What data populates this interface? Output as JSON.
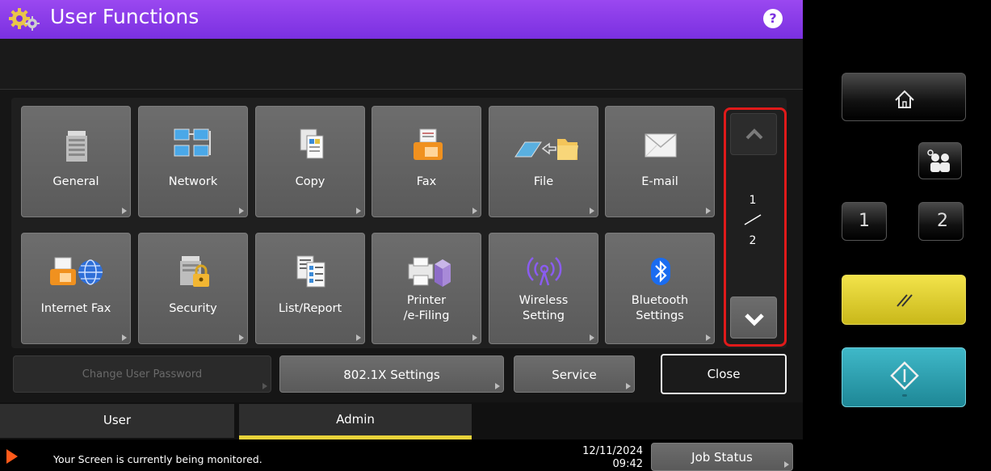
{
  "header": {
    "title": "User Functions",
    "help_label": "?"
  },
  "functions": [
    {
      "label": "General",
      "icon": "copier-icon"
    },
    {
      "label": "Network",
      "icon": "network-icon"
    },
    {
      "label": "Copy",
      "icon": "copy-icon"
    },
    {
      "label": "Fax",
      "icon": "fax-icon"
    },
    {
      "label": "File",
      "icon": "file-folder-icon"
    },
    {
      "label": "E-mail",
      "icon": "envelope-icon"
    },
    {
      "label": "Internet Fax",
      "icon": "internet-fax-icon"
    },
    {
      "label": "Security",
      "icon": "security-lock-icon"
    },
    {
      "label": "List/Report",
      "icon": "list-report-icon"
    },
    {
      "label_line1": "Printer",
      "label_line2": "/e-Filing",
      "icon": "printer-efiling-icon"
    },
    {
      "label_line1": "Wireless",
      "label_line2": "Setting",
      "icon": "wireless-icon"
    },
    {
      "label_line1": "Bluetooth",
      "label_line2": "Settings",
      "icon": "bluetooth-icon"
    }
  ],
  "pagination": {
    "current": "1",
    "total": "2"
  },
  "bottom_buttons": {
    "change_password": "Change User Password",
    "dot1x": "802.1X Settings",
    "service": "Service",
    "close": "Close"
  },
  "tabs": {
    "user": "User",
    "admin": "Admin",
    "active": "Admin"
  },
  "status": {
    "message": "Your Screen is currently being monitored.",
    "date": "12/11/2024",
    "time": "09:42",
    "job_status": "Job Status"
  },
  "hardware": {
    "one": "1",
    "two": "2"
  },
  "colors": {
    "title_bar": "#8a3cf0",
    "highlight_outline": "#e01a1a",
    "active_tab_underline": "#e8d33a",
    "clear_button": "#e6d632",
    "start_button": "#2fa3b3"
  }
}
